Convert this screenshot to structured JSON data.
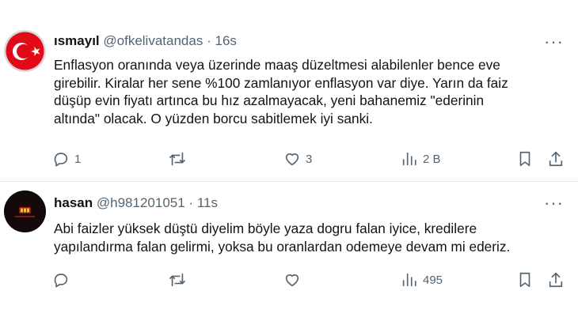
{
  "tweets": [
    {
      "name": "ısmayıl",
      "handle": "@ofkelivatandas",
      "separator": "·",
      "time": "16s",
      "more": "···",
      "text_lines": [
        "Enflasyon oranında veya üzerinde maaş düzeltmesi alabilenler bence eve",
        "girebilir. Kiralar her sene %100 zamlanıyor enflasyon var diye. Yarın da faiz",
        "düşüp evin fiyatı artınca bu hız azalmayacak, yeni bahanemiz \"ederinin",
        "altında\" olacak. O yüzden borcu sabitlemek iyi sanki."
      ],
      "replies": "1",
      "retweets": "",
      "likes": "3",
      "views": "2 B",
      "avatar_icon": "turkish-flag-icon"
    },
    {
      "name": "hasan",
      "handle": "@h981201051",
      "separator": "·",
      "time": "11s",
      "more": "···",
      "text_lines": [
        "Abi faizler yüksek düştü diyelim böyle yaza dogru falan iyice, kredilere",
        "yapılandırma falan gelirmi, yoksa bu oranlardan odemeye devam mi ederiz."
      ],
      "replies": "",
      "retweets": "",
      "likes": "",
      "views": "495",
      "avatar_icon": "dark-logo-icon"
    }
  ],
  "colors": {
    "text": "#0f1419",
    "muted": "#536471",
    "divider": "#e6e9ec",
    "flag_red": "#e30a17"
  }
}
